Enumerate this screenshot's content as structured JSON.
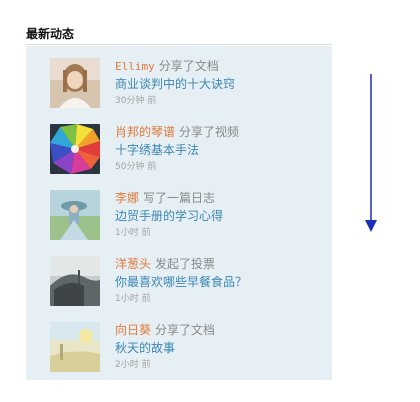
{
  "section": {
    "title": "最新动态"
  },
  "feed": {
    "items": [
      {
        "user": "Ellimy",
        "action": "分享了文档",
        "title": "商业谈判中的十大诀窍",
        "time": "30分钟 前",
        "avatar": "girl-portrait"
      },
      {
        "user": "肖邦的琴谱",
        "action": "分享了视频",
        "title": "十字绣基本手法",
        "time": "50分钟 前",
        "avatar": "colored-pencils"
      },
      {
        "user": "李娜",
        "action": "写了一篇日志",
        "title": "边贸手册的学习心得",
        "time": "1小时 前",
        "avatar": "figure-in-field"
      },
      {
        "user": "洋葱头",
        "action": "发起了投票",
        "title": "你最喜欢哪些早餐食品？",
        "time": "1小时 前",
        "avatar": "gray-landscape"
      },
      {
        "user": "向日葵",
        "action": "分享了文档",
        "title": "秋天的故事",
        "time": "2小时 前",
        "avatar": "pale-scene"
      }
    ]
  },
  "colors": {
    "panel_bg": "#e6eff3",
    "user_name": "#e07a3c",
    "action_text": "#8a8a8a",
    "title_link": "#3b86b5",
    "time_text": "#a5a5a5",
    "scroll_arrow": "#1a2fb8"
  }
}
